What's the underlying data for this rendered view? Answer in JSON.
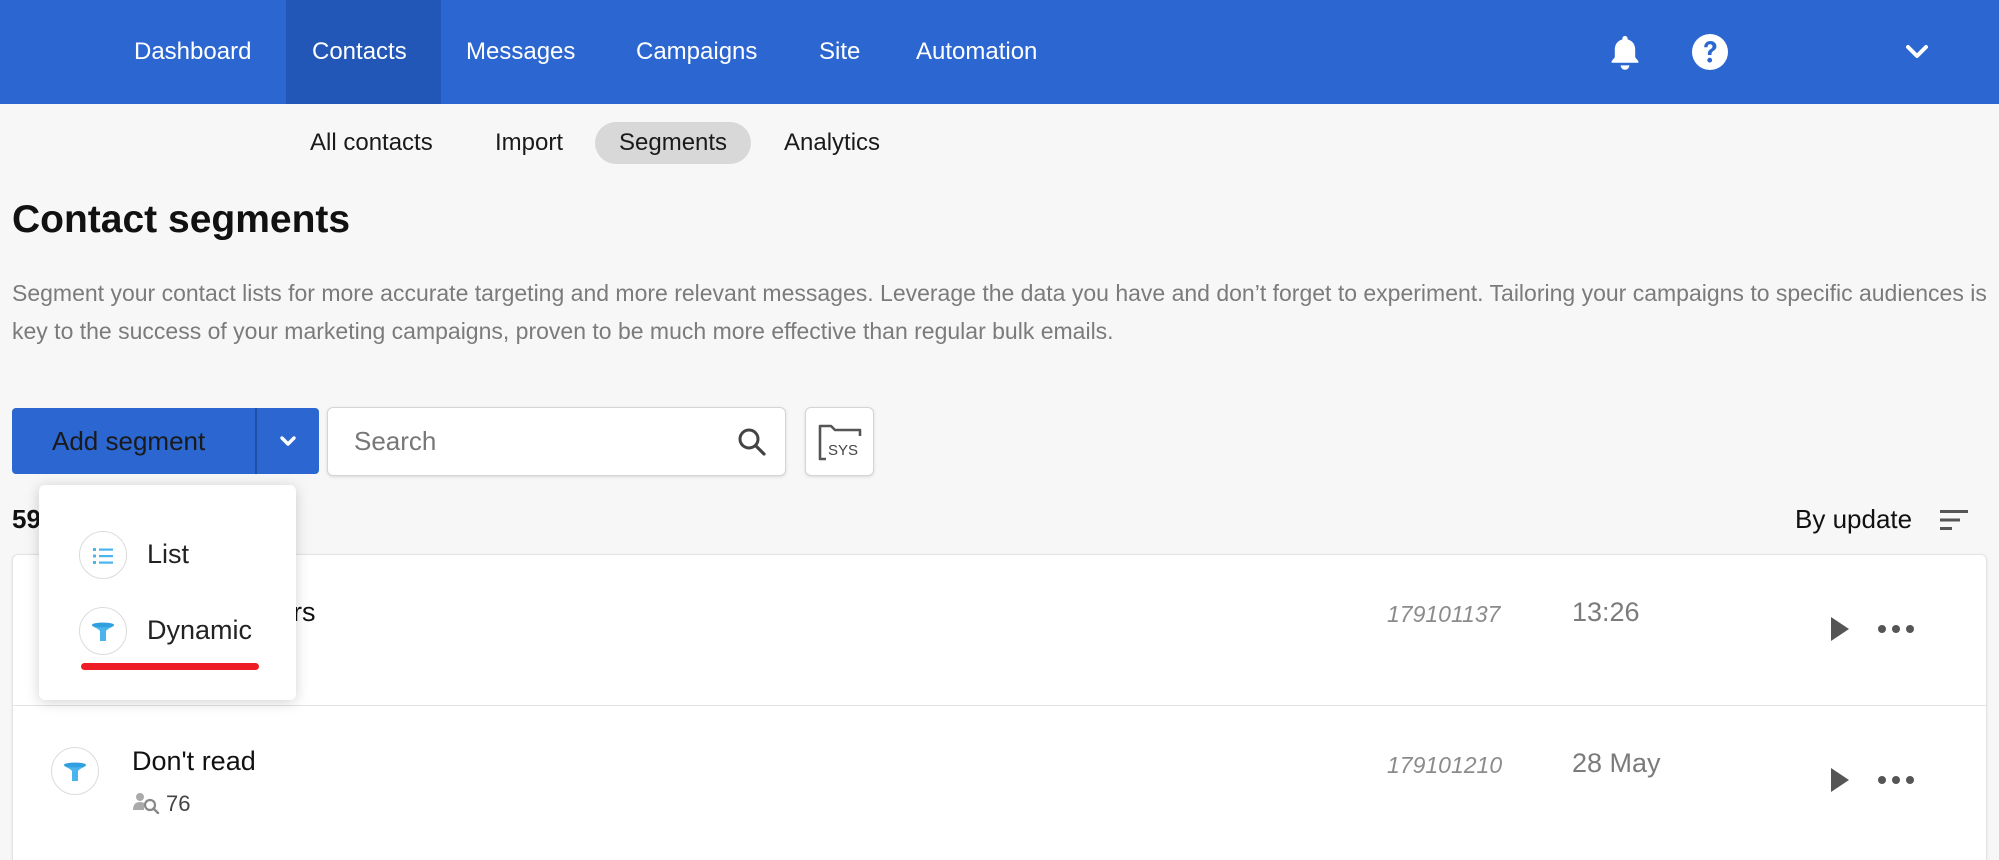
{
  "topnav": {
    "items": [
      {
        "label": "Dashboard"
      },
      {
        "label": "Contacts",
        "active": true
      },
      {
        "label": "Messages"
      },
      {
        "label": "Campaigns"
      },
      {
        "label": "Site"
      },
      {
        "label": "Automation"
      }
    ],
    "icons": [
      "bell-icon",
      "help-icon",
      "chevron-down-icon"
    ],
    "accent_color": "#2b66d1"
  },
  "subnav": {
    "items": [
      {
        "label": "All contacts"
      },
      {
        "label": "Import"
      },
      {
        "label": "Segments",
        "active": true
      },
      {
        "label": "Analytics"
      }
    ]
  },
  "page": {
    "title": "Contact segments",
    "description": "Segment your contact lists for more accurate targeting and more relevant messages. Leverage the data you have and don’t forget to experiment. Tailoring your campaigns to specific audiences is key to the success of your marketing campaigns, proven to be much more effective than regular bulk emails."
  },
  "toolbar": {
    "add_label": "Add segment",
    "search_placeholder": "Search",
    "sys_label": "SYS",
    "count_visible": "59",
    "sort_label": "By update"
  },
  "dropdown": {
    "items": [
      {
        "label": "List",
        "icon": "list-icon"
      },
      {
        "label": "Dynamic",
        "icon": "funnel-icon"
      }
    ],
    "highlight_color": "#ee1c24"
  },
  "segments": [
    {
      "name_visible": "rs",
      "id": "179101137",
      "date": "13:26",
      "icon": "funnel-icon"
    },
    {
      "name": "Don't read",
      "count": "76",
      "id": "179101210",
      "date": "28 May",
      "icon": "funnel-icon"
    }
  ]
}
